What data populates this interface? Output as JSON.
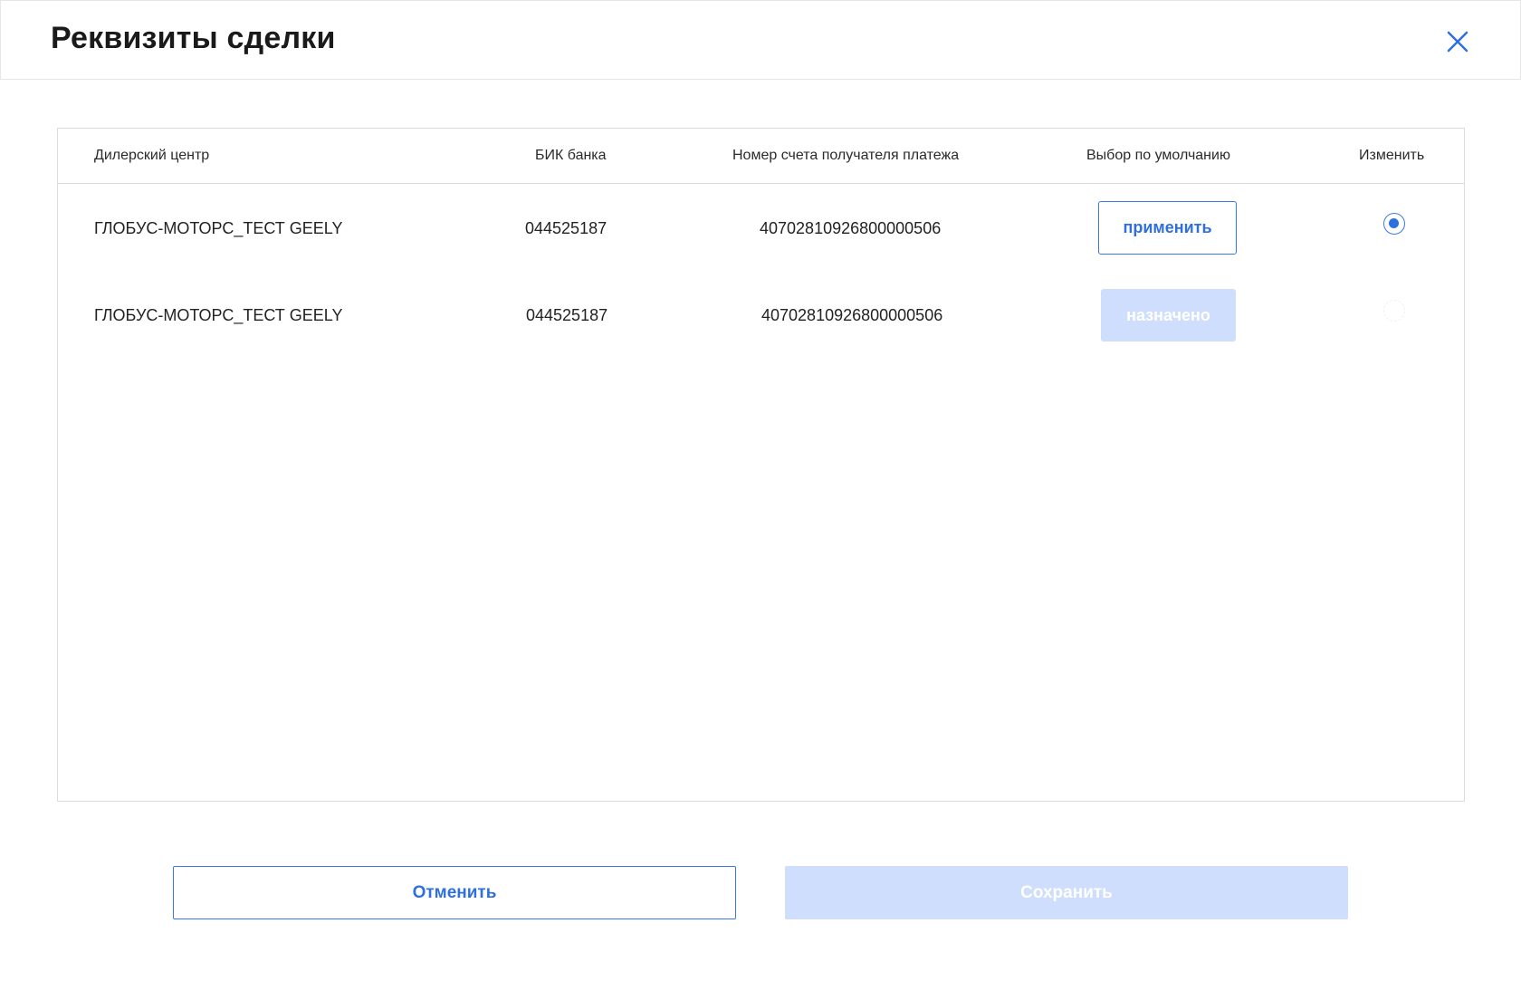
{
  "dialog": {
    "title": "Реквизиты сделки"
  },
  "icons": {
    "close": "close-icon",
    "accent_color": "#2f6fdf",
    "disabled_color": "#cfdefc"
  },
  "table": {
    "columns": [
      "Дилерский центр",
      "БИК банка",
      "Номер счета получателя платежа",
      "Выбор по умолчанию",
      "Изменить"
    ],
    "rows": [
      {
        "dealer": "ГЛОБУС-МОТОРС_ТЕСТ GEELY",
        "bik": "044525187",
        "account": "40702810926800000506",
        "default_action": "применить",
        "selected": true
      },
      {
        "dealer": "ГЛОБУС-МОТОРС_ТЕСТ GEELY",
        "bik": "044525187",
        "account": "40702810926800000506",
        "default_action": "назначено",
        "selected": false
      }
    ]
  },
  "footer": {
    "cancel_label": "Отменить",
    "save_label": "Сохранить"
  }
}
